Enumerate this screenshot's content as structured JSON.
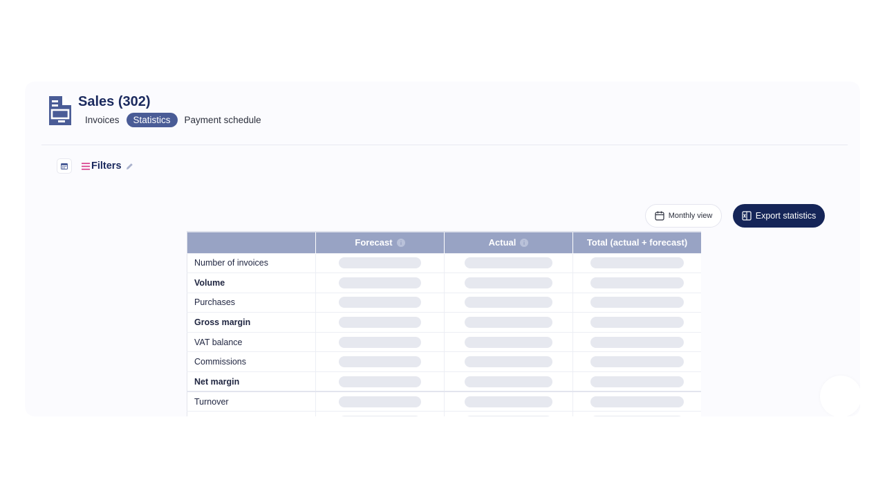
{
  "header": {
    "title": "Sales (302)",
    "icon": "document-icon",
    "tabs": [
      {
        "label": "Invoices",
        "active": false
      },
      {
        "label": "Statistics",
        "active": true
      },
      {
        "label": "Payment schedule",
        "active": false
      }
    ]
  },
  "filters": {
    "calendar_icon": "calendar-icon",
    "label": "Filters",
    "menu_icon": "menu-lines-icon",
    "edit_icon": "pencil-icon"
  },
  "toolbar": {
    "monthly_view_label": "Monthly view",
    "export_label": "Export statistics"
  },
  "table": {
    "columns": [
      "",
      "Forecast",
      "Actual",
      "Total (actual + forecast)"
    ],
    "rows": [
      {
        "label": "Number of invoices",
        "bold": false
      },
      {
        "label": "Volume",
        "bold": true
      },
      {
        "label": "Purchases",
        "bold": false
      },
      {
        "label": "Gross margin",
        "bold": true
      },
      {
        "label": "VAT balance",
        "bold": false
      },
      {
        "label": "Commissions",
        "bold": false
      },
      {
        "label": "Net margin",
        "bold": true
      },
      {
        "label": "Turnover",
        "bold": false
      },
      {
        "label": "",
        "bold": false
      }
    ],
    "values_state": "loading"
  },
  "colors": {
    "primary": "#152558",
    "accent": "#4a5c96",
    "table_header": "#98a3c4",
    "filters_pink": "#d63384"
  }
}
